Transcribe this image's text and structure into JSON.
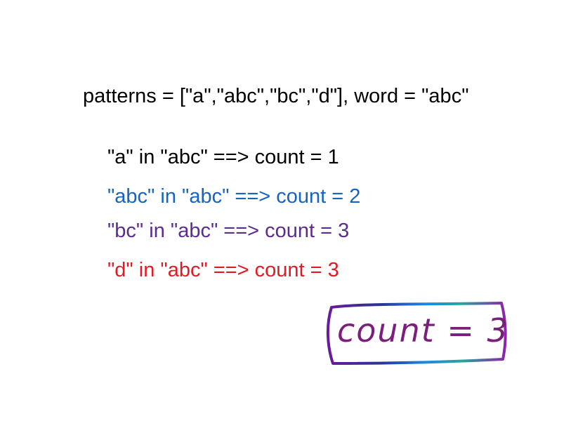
{
  "header": {
    "text": "patterns = [\"a\",\"abc\",\"bc\",\"d\"], word = \"abc\"",
    "color": "#000000"
  },
  "steps": [
    {
      "text": "\"a\" in \"abc\" ==> count = 1",
      "color": "#000000"
    },
    {
      "text": "\"abc\" in \"abc\" ==> count = 2",
      "color": "#1565c0"
    },
    {
      "text": "\"bc\" in \"abc\" ==> count = 3",
      "color": "#5b2d91"
    },
    {
      "text": "\"d\" in \"abc\" ==> count = 3",
      "color": "#e01b24"
    }
  ],
  "answer": {
    "text": "count = 3",
    "ink_color": "#7a1f7a",
    "border_colors": [
      "#6a1b9a",
      "#283593",
      "#1e88e5",
      "#26a69a",
      "#8e24aa"
    ]
  }
}
